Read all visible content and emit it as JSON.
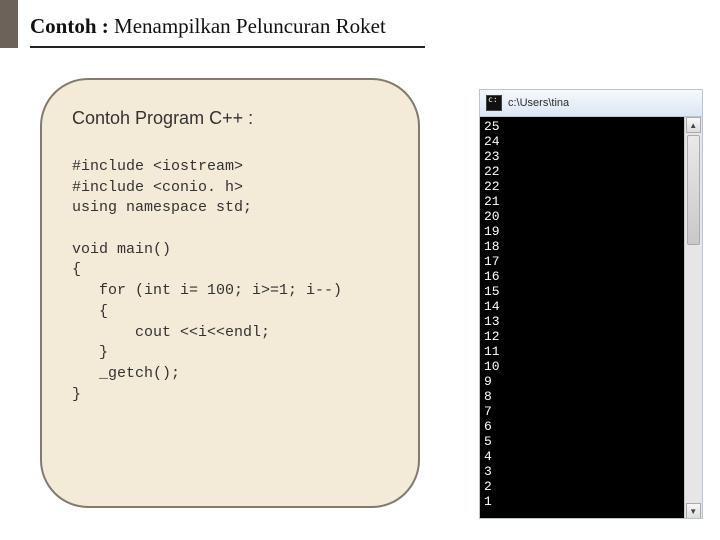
{
  "title": {
    "bold": "Contoh :",
    "rest": " Menampilkan Peluncuran Roket"
  },
  "card": {
    "subtitle": "Contoh Program C++ :",
    "code": "#include <iostream>\n#include <conio. h>\nusing namespace std;\n\nvoid main()\n{\n   for (int i= 100; i>=1; i--)\n   {\n       cout <<i<<endl;\n   }\n   _getch();\n}"
  },
  "console": {
    "title_path": "c:\\Users\\tina",
    "output": "25\n24\n23\n22\n22\n21\n20\n19\n18\n17\n16\n15\n14\n13\n12\n11\n10\n9\n8\n7\n6\n5\n4\n3\n2\n1",
    "scroll_up_glyph": "▲",
    "scroll_down_glyph": "▼"
  }
}
